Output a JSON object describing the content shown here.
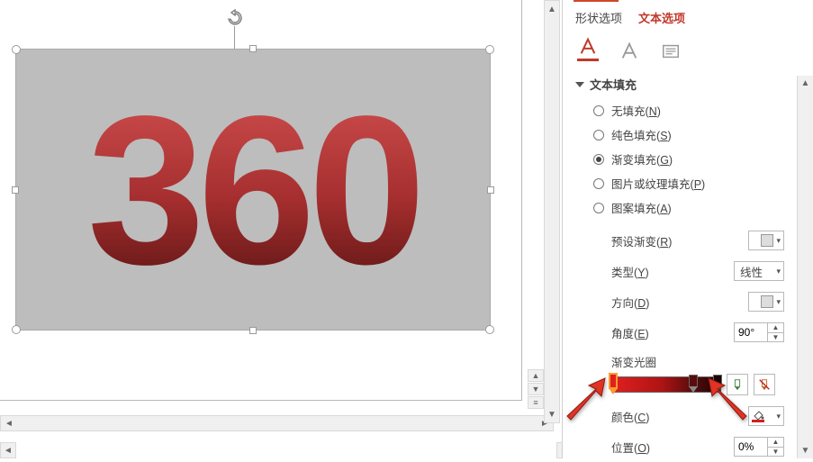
{
  "canvas": {
    "big_text": "360"
  },
  "panel": {
    "tabs": {
      "shape_options": "形状选项",
      "text_options": "文本选项"
    },
    "section_title": "文本填充",
    "fills": {
      "none": {
        "label": "无填充",
        "accel": "N"
      },
      "solid": {
        "label": "纯色填充",
        "accel": "S"
      },
      "gradient": {
        "label": "渐变填充",
        "accel": "G"
      },
      "picture": {
        "label": "图片或纹理填充",
        "accel": "P"
      },
      "pattern": {
        "label": "图案填充",
        "accel": "A"
      }
    },
    "props": {
      "preset": {
        "label": "预设渐变",
        "accel": "R"
      },
      "type": {
        "label": "类型",
        "accel": "Y",
        "value": "线性"
      },
      "direction": {
        "label": "方向",
        "accel": "D"
      },
      "angle": {
        "label": "角度",
        "accel": "E",
        "value": "90°"
      },
      "stops": {
        "label": "渐变光圈"
      },
      "color": {
        "label": "颜色",
        "accel": "C"
      },
      "position": {
        "label": "位置",
        "accel": "O",
        "value": "0%"
      }
    }
  }
}
